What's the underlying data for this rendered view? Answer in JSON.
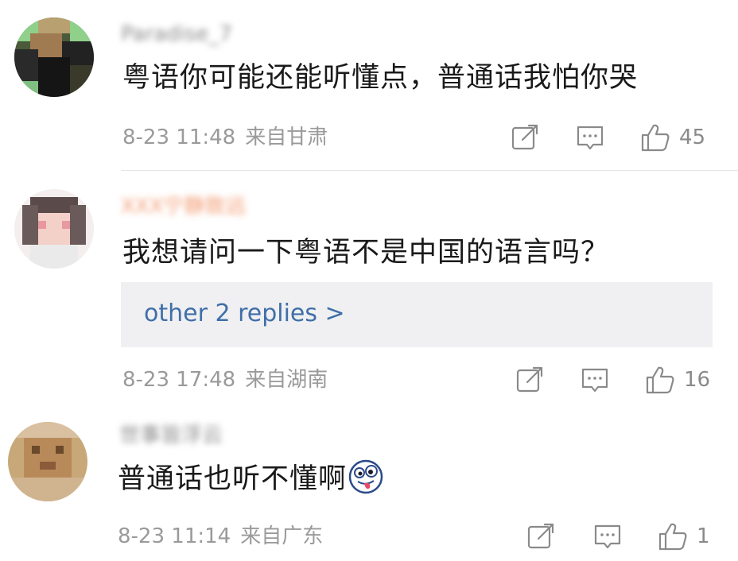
{
  "comments": [
    {
      "username": "Paradise_7",
      "text": "粤语你可能还能听懂点，普通话我怕你哭",
      "time": "8-23 11:48",
      "location": "来自甘肃",
      "likes": "45"
    },
    {
      "username": "XXX宁静致远",
      "text": "我想请问一下粤语不是中国的语言吗？",
      "replies_label": "other 2 replies >",
      "time": "8-23 17:48",
      "location": "来自湖南",
      "likes": "16"
    },
    {
      "username": "世事皆浮云",
      "text": "普通话也听不懂啊",
      "emoji": "crazy-face-emoji",
      "time": "8-23 11:14",
      "location": "来自广东",
      "likes": "1"
    }
  ],
  "icons": {
    "share": "share-icon",
    "comment": "comment-icon",
    "like": "like-icon"
  },
  "colors": {
    "link": "#3f6fa8",
    "meta": "#9a9a9a",
    "reply_bg": "#f0f0f2"
  }
}
